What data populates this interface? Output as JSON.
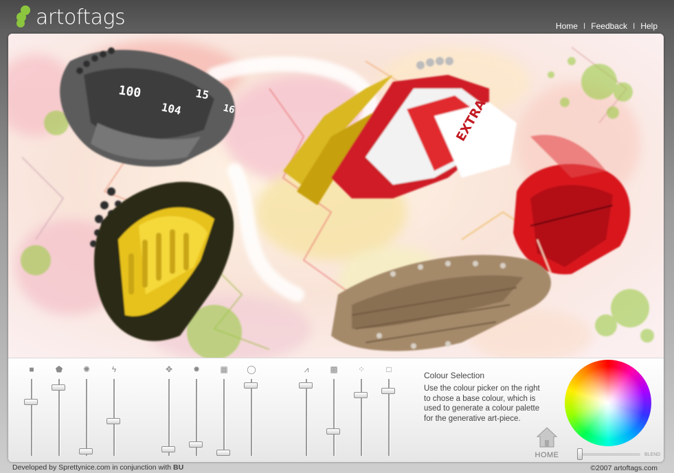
{
  "header": {
    "logo_text": "artoftags",
    "nav": [
      "Home",
      "Feedback",
      "Help"
    ],
    "nav_separator": "I"
  },
  "artwork": {
    "labels": [
      "100",
      "15",
      "104",
      "16",
      "EXTRA"
    ],
    "colors": {
      "gray": "#5a5a5a",
      "yellow": "#e8c21a",
      "red": "#d8181c",
      "wood": "#a58a6a",
      "green": "#8cc63f"
    }
  },
  "controls": {
    "sliders": [
      {
        "icon": "■",
        "icon_name": "square-icon",
        "value": 0.72
      },
      {
        "icon": "⬟",
        "icon_name": "pentagon-icon",
        "value": 0.92
      },
      {
        "icon": "✺",
        "icon_name": "burst-icon",
        "value": 0.02
      },
      {
        "icon": "ϟ",
        "icon_name": "zigzag-icon",
        "value": 0.45
      },
      {
        "icon": "✥",
        "icon_name": "splat-icon",
        "value": 0.05
      },
      {
        "icon": "✹",
        "icon_name": "star-icon",
        "value": 0.12
      },
      {
        "icon": "▦",
        "icon_name": "grid-icon",
        "value": 0.0
      },
      {
        "icon": "◯",
        "icon_name": "circle-icon",
        "value": 0.95
      },
      {
        "icon": "⩘",
        "icon_name": "stroke-icon",
        "value": 0.95
      },
      {
        "icon": "▩",
        "icon_name": "texture-icon",
        "value": 0.3
      },
      {
        "icon": "⁘",
        "icon_name": "dots-icon",
        "value": 0.82
      },
      {
        "icon": "□",
        "icon_name": "outline-square-icon",
        "value": 0.87
      }
    ],
    "colour_selection": {
      "title": "Colour Selection",
      "text": "Use the colour picker on the right to chose a base colour, which is used to generate a colour palette for the generative art-piece."
    },
    "home_label": "HOME",
    "blend_label": "BLEND",
    "blend_value": 0.0
  },
  "footer": {
    "developed": "Developed by Sprettynice.com in conjunction with",
    "partner": "BU",
    "copyright": "©2007 artoftags.com"
  }
}
